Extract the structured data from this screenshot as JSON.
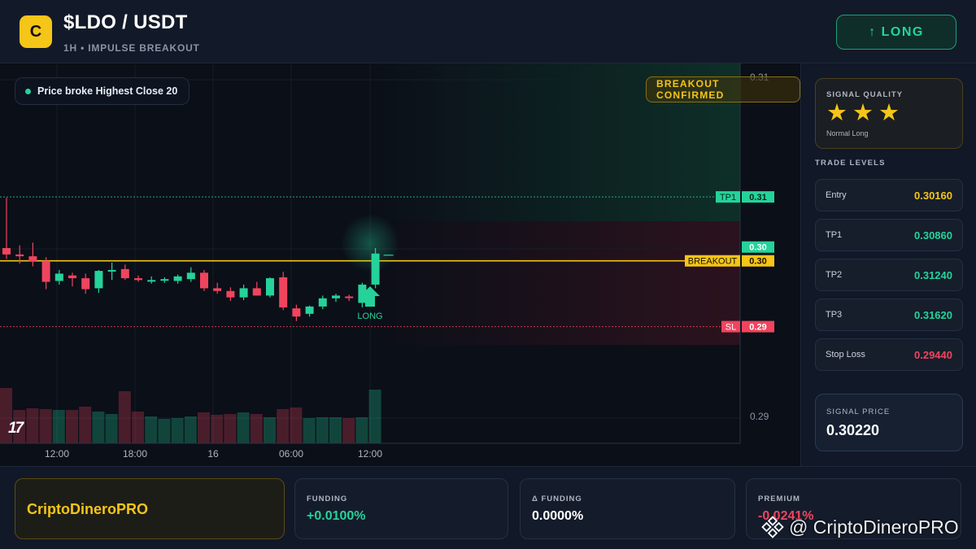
{
  "header": {
    "logo_letter": "C",
    "pair": "$LDO / USDT",
    "subtitle": "1H • IMPULSE BREAKOUT",
    "direction_button": "↑ LONG"
  },
  "chart": {
    "legend_label": "Price broke Highest Close 20",
    "breakout_badge": "BREAKOUT CONFIRMED",
    "signal_marker_label": "LONG",
    "tradingview_logo": "17",
    "price_scale_ticks": [
      "0.31",
      "0.30",
      "0.29"
    ],
    "time_ticks": [
      "12:00",
      "18:00",
      "16",
      "06:00",
      "12:00"
    ],
    "level_tags": {
      "tp1": {
        "name": "TP1",
        "value": "0.31"
      },
      "breakout": {
        "name": "BREAKOUT",
        "value": "0.30"
      },
      "last": {
        "value": "0.30"
      },
      "sl": {
        "name": "SL",
        "value": "0.29"
      }
    },
    "colors": {
      "up": "#25d39a",
      "down": "#f0445e",
      "breakout": "#f5c518"
    }
  },
  "chart_data": {
    "type": "candlestick",
    "title": "",
    "candles": [
      {
        "o": 0.303,
        "h": 0.3085,
        "l": 0.3018,
        "c": 0.3023
      },
      {
        "o": 0.3023,
        "h": 0.3033,
        "l": 0.3013,
        "c": 0.3021
      },
      {
        "o": 0.3021,
        "h": 0.3036,
        "l": 0.301,
        "c": 0.3015
      },
      {
        "o": 0.3016,
        "h": 0.302,
        "l": 0.2985,
        "c": 0.2993
      },
      {
        "o": 0.2994,
        "h": 0.3006,
        "l": 0.299,
        "c": 0.3002
      },
      {
        "o": 0.3,
        "h": 0.3003,
        "l": 0.2988,
        "c": 0.2997
      },
      {
        "o": 0.2997,
        "h": 0.3002,
        "l": 0.298,
        "c": 0.2985
      },
      {
        "o": 0.2986,
        "h": 0.3006,
        "l": 0.2981,
        "c": 0.3005
      },
      {
        "o": 0.3006,
        "h": 0.3014,
        "l": 0.2995,
        "c": 0.3006
      },
      {
        "o": 0.3007,
        "h": 0.3012,
        "l": 0.2995,
        "c": 0.2997
      },
      {
        "o": 0.2997,
        "h": 0.3,
        "l": 0.2993,
        "c": 0.2995
      },
      {
        "o": 0.2995,
        "h": 0.2999,
        "l": 0.2991,
        "c": 0.2995
      },
      {
        "o": 0.2995,
        "h": 0.2998,
        "l": 0.2992,
        "c": 0.2996
      },
      {
        "o": 0.2994,
        "h": 0.3001,
        "l": 0.2991,
        "c": 0.2999
      },
      {
        "o": 0.2996,
        "h": 0.3009,
        "l": 0.2993,
        "c": 0.3003
      },
      {
        "o": 0.3003,
        "h": 0.3006,
        "l": 0.2983,
        "c": 0.2986
      },
      {
        "o": 0.2986,
        "h": 0.2992,
        "l": 0.298,
        "c": 0.2983
      },
      {
        "o": 0.2983,
        "h": 0.2987,
        "l": 0.2972,
        "c": 0.2976
      },
      {
        "o": 0.2976,
        "h": 0.299,
        "l": 0.2973,
        "c": 0.2986
      },
      {
        "o": 0.2986,
        "h": 0.2993,
        "l": 0.2978,
        "c": 0.2978
      },
      {
        "o": 0.2978,
        "h": 0.2998,
        "l": 0.2976,
        "c": 0.2997
      },
      {
        "o": 0.2998,
        "h": 0.3004,
        "l": 0.2962,
        "c": 0.2965
      },
      {
        "o": 0.2964,
        "h": 0.2968,
        "l": 0.295,
        "c": 0.2955
      },
      {
        "o": 0.2958,
        "h": 0.2967,
        "l": 0.2955,
        "c": 0.2966
      },
      {
        "o": 0.2966,
        "h": 0.2978,
        "l": 0.2963,
        "c": 0.2975
      },
      {
        "o": 0.2975,
        "h": 0.298,
        "l": 0.2971,
        "c": 0.2978
      },
      {
        "o": 0.2977,
        "h": 0.2979,
        "l": 0.2972,
        "c": 0.2976
      },
      {
        "o": 0.297,
        "h": 0.2992,
        "l": 0.2965,
        "c": 0.299
      },
      {
        "o": 0.299,
        "h": 0.303,
        "l": 0.2986,
        "c": 0.3024
      }
    ],
    "levels": {
      "tp1": 0.3086,
      "breakout": 0.3016,
      "sl": 0.2944
    },
    "volume": [
      68,
      41,
      43,
      42,
      41,
      41,
      45,
      39,
      36,
      64,
      39,
      33,
      30,
      31,
      33,
      38,
      35,
      36,
      38,
      36,
      32,
      42,
      44,
      31,
      32,
      32,
      31,
      32,
      66
    ]
  },
  "signal_quality": {
    "title": "SIGNAL QUALITY",
    "rating": 3,
    "rating_max": 3,
    "subtitle": "Normal Long"
  },
  "trade_levels": {
    "title": "TRADE LEVELS",
    "rows": [
      {
        "label": "Entry",
        "value": "0.30160",
        "color": "#f5c518"
      },
      {
        "label": "TP1",
        "value": "0.30860",
        "color": "#25d39a"
      },
      {
        "label": "TP2",
        "value": "0.31240",
        "color": "#25d39a"
      },
      {
        "label": "TP3",
        "value": "0.31620",
        "color": "#25d39a"
      },
      {
        "label": "Stop Loss",
        "value": "0.29440",
        "color": "#f0445e"
      }
    ]
  },
  "signal_price": {
    "title": "SIGNAL PRICE",
    "value": "0.30220"
  },
  "footer": {
    "brand": "CriptoDineroPRO",
    "funding": {
      "title": "FUNDING",
      "value": "+0.0100%"
    },
    "delta_funding": {
      "title": "Δ FUNDING",
      "value": "0.0000%"
    },
    "premium": {
      "title": "PREMIUM",
      "value": "-0.0241%"
    }
  },
  "watermark": {
    "text": "@ CriptoDineroPRO"
  }
}
